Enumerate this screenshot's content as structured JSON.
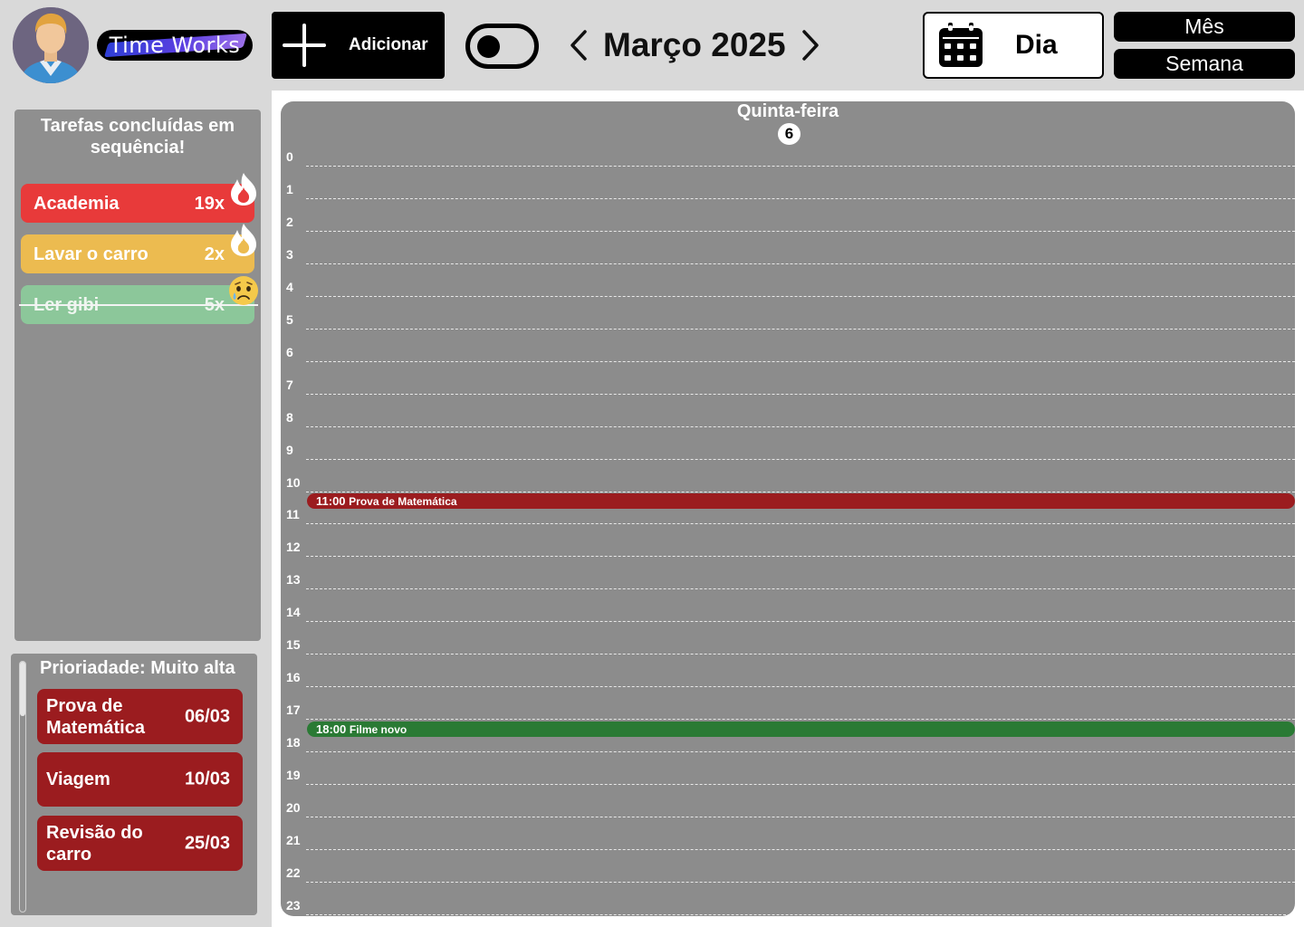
{
  "header": {
    "app_name": "Time Works",
    "add_label": "Adicionar",
    "month_title": "Março 2025",
    "view_day": "Dia",
    "view_month": "Mês",
    "view_week": "Semana"
  },
  "streaks": {
    "title": "Tarefas concluídas em sequência!",
    "items": [
      {
        "name": "Academia",
        "count": "19x",
        "color": "#e83a3a",
        "status": "fire-icon"
      },
      {
        "name": "Lavar o carro",
        "count": "2x",
        "color": "#ecbb50",
        "status": "fire-icon"
      },
      {
        "name": "Ler gibi",
        "count": "5x",
        "color": "#8cc79a",
        "status": "sad-face-icon",
        "broken": true
      }
    ]
  },
  "priority": {
    "title": "Prioriadade: Muito alta",
    "items": [
      {
        "name": "Prova de Matemática",
        "date": "06/03"
      },
      {
        "name": "Viagem",
        "date": "10/03"
      },
      {
        "name": "Revisão do carro",
        "date": "25/03"
      }
    ]
  },
  "day": {
    "weekday": "Quinta-feira",
    "date_number": "6",
    "hours": [
      "0",
      "1",
      "2",
      "3",
      "4",
      "5",
      "6",
      "7",
      "8",
      "9",
      "10",
      "11",
      "12",
      "13",
      "14",
      "15",
      "16",
      "17",
      "18",
      "19",
      "20",
      "21",
      "22",
      "23"
    ],
    "events": [
      {
        "time": "11:00",
        "title": "Prova de Matemática",
        "color": "#9b1c1f"
      },
      {
        "time": "18:00",
        "title": "Filme novo",
        "color": "#2a7a34"
      }
    ]
  }
}
